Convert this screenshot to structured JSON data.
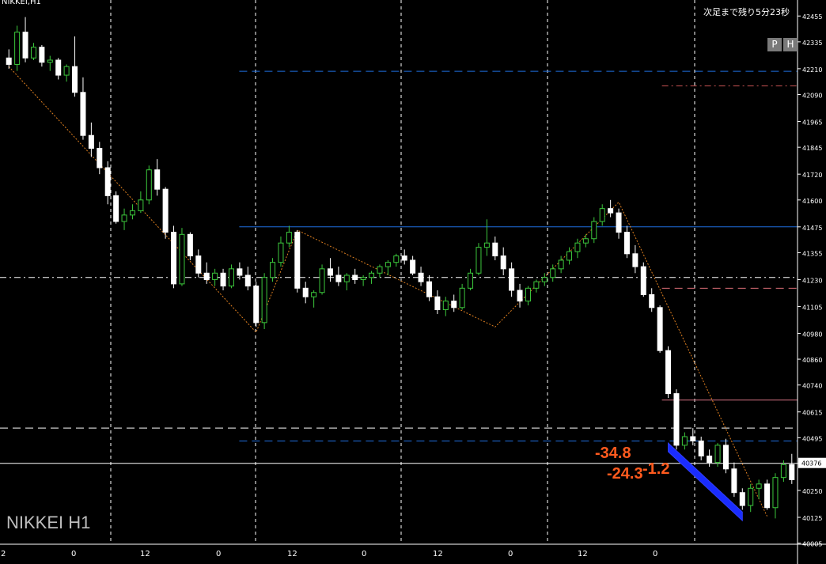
{
  "window": {
    "title": "NIKKEI,H1",
    "countdown": "次足まで残り5分23秒"
  },
  "buttons": {
    "p": "P",
    "h": "H"
  },
  "watermark": "NIKKEI H1",
  "current_price": "40376",
  "annotations": [
    "-34.8",
    "-24.3",
    "-1.2"
  ],
  "chart_data": {
    "type": "candlestick",
    "title": "NIKKEI,H1",
    "ylim": [
      40000,
      42500
    ],
    "y_ticks": [
      "42455",
      "42335",
      "42210",
      "42090",
      "41965",
      "41845",
      "41720",
      "41600",
      "41475",
      "41355",
      "41230",
      "41105",
      "40980",
      "40860",
      "40740",
      "40615",
      "40495",
      "40376",
      "40250",
      "40125",
      "40005"
    ],
    "x_ticks": [
      "2",
      "0",
      "12",
      "0",
      "12",
      "0",
      "12",
      "0",
      "12",
      "0"
    ],
    "candles": [
      [
        42260,
        42300,
        42210,
        42230
      ],
      [
        42230,
        42410,
        42200,
        42380
      ],
      [
        42380,
        42450,
        42240,
        42260
      ],
      [
        42260,
        42330,
        42250,
        42310
      ],
      [
        42310,
        42320,
        42220,
        42240
      ],
      [
        42240,
        42270,
        42200,
        42250
      ],
      [
        42250,
        42260,
        42160,
        42180
      ],
      [
        42180,
        42230,
        42150,
        42220
      ],
      [
        42220,
        42360,
        42080,
        42100
      ],
      [
        42100,
        42170,
        41880,
        41900
      ],
      [
        41900,
        41960,
        41800,
        41840
      ],
      [
        41840,
        41870,
        41720,
        41750
      ],
      [
        41750,
        41780,
        41580,
        41620
      ],
      [
        41620,
        41640,
        41490,
        41500
      ],
      [
        41500,
        41560,
        41460,
        41530
      ],
      [
        41530,
        41580,
        41510,
        41550
      ],
      [
        41550,
        41640,
        41540,
        41600
      ],
      [
        41600,
        41760,
        41580,
        41740
      ],
      [
        41740,
        41790,
        41620,
        41650
      ],
      [
        41650,
        41660,
        41420,
        41450
      ],
      [
        41450,
        41480,
        41190,
        41210
      ],
      [
        41210,
        41470,
        41200,
        41440
      ],
      [
        41440,
        41450,
        41320,
        41340
      ],
      [
        41340,
        41370,
        41240,
        41260
      ],
      [
        41260,
        41310,
        41210,
        41230
      ],
      [
        41230,
        41280,
        41200,
        41260
      ],
      [
        41260,
        41280,
        41180,
        41200
      ],
      [
        41200,
        41300,
        41190,
        41280
      ],
      [
        41280,
        41310,
        41230,
        41250
      ],
      [
        41250,
        41290,
        41180,
        41200
      ],
      [
        41200,
        41220,
        41010,
        41030
      ],
      [
        41030,
        41260,
        41000,
        41240
      ],
      [
        41240,
        41330,
        41220,
        41310
      ],
      [
        41310,
        41430,
        41290,
        41400
      ],
      [
        41400,
        41480,
        41380,
        41450
      ],
      [
        41450,
        41460,
        41170,
        41190
      ],
      [
        41190,
        41220,
        41120,
        41150
      ],
      [
        41150,
        41180,
        41100,
        41170
      ],
      [
        41170,
        41300,
        41160,
        41280
      ],
      [
        41280,
        41330,
        41220,
        41250
      ],
      [
        41250,
        41290,
        41200,
        41220
      ],
      [
        41220,
        41260,
        41180,
        41250
      ],
      [
        41250,
        41280,
        41210,
        41230
      ],
      [
        41230,
        41250,
        41200,
        41240
      ],
      [
        41240,
        41270,
        41210,
        41260
      ],
      [
        41260,
        41300,
        41240,
        41290
      ],
      [
        41290,
        41320,
        41250,
        41310
      ],
      [
        41310,
        41350,
        41290,
        41340
      ],
      [
        41340,
        41370,
        41300,
        41320
      ],
      [
        41320,
        41340,
        41250,
        41260
      ],
      [
        41260,
        41290,
        41200,
        41220
      ],
      [
        41220,
        41250,
        41130,
        41150
      ],
      [
        41150,
        41180,
        41070,
        41090
      ],
      [
        41090,
        41150,
        41060,
        41130
      ],
      [
        41130,
        41160,
        41080,
        41100
      ],
      [
        41100,
        41210,
        41090,
        41190
      ],
      [
        41190,
        41280,
        41180,
        41260
      ],
      [
        41260,
        41400,
        41250,
        41380
      ],
      [
        41380,
        41510,
        41340,
        41400
      ],
      [
        41400,
        41430,
        41320,
        41340
      ],
      [
        41340,
        41380,
        41250,
        41280
      ],
      [
        41280,
        41310,
        41150,
        41180
      ],
      [
        41180,
        41210,
        41100,
        41130
      ],
      [
        41130,
        41200,
        41110,
        41190
      ],
      [
        41190,
        41230,
        41170,
        41220
      ],
      [
        41220,
        41260,
        41200,
        41240
      ],
      [
        41240,
        41300,
        41220,
        41280
      ],
      [
        41280,
        41340,
        41260,
        41320
      ],
      [
        41320,
        41380,
        41300,
        41360
      ],
      [
        41360,
        41420,
        41330,
        41400
      ],
      [
        41400,
        41440,
        41380,
        41420
      ],
      [
        41420,
        41520,
        41400,
        41500
      ],
      [
        41500,
        41580,
        41480,
        41560
      ],
      [
        41560,
        41600,
        41520,
        41540
      ],
      [
        41540,
        41560,
        41420,
        41450
      ],
      [
        41450,
        41480,
        41330,
        41350
      ],
      [
        41350,
        41390,
        41260,
        41290
      ],
      [
        41290,
        41310,
        41150,
        41160
      ],
      [
        41160,
        41190,
        41080,
        41100
      ],
      [
        41100,
        41110,
        40890,
        40900
      ],
      [
        40900,
        40920,
        40680,
        40700
      ],
      [
        40700,
        40720,
        40440,
        40460
      ],
      [
        40460,
        40520,
        40440,
        40500
      ],
      [
        40500,
        40540,
        40460,
        40480
      ],
      [
        40480,
        40500,
        40390,
        40410
      ],
      [
        40410,
        40440,
        40360,
        40380
      ],
      [
        40380,
        40470,
        40360,
        40460
      ],
      [
        40460,
        40490,
        40330,
        40350
      ],
      [
        40350,
        40380,
        40220,
        40240
      ],
      [
        40240,
        40260,
        40160,
        40180
      ],
      [
        40180,
        40280,
        40150,
        40260
      ],
      [
        40260,
        40300,
        40210,
        40280
      ],
      [
        40280,
        40300,
        40160,
        40170
      ],
      [
        40170,
        40330,
        40120,
        40310
      ],
      [
        40310,
        40390,
        40290,
        40370
      ],
      [
        40370,
        40420,
        40280,
        40300
      ]
    ],
    "zigzag": [
      [
        0,
        42220
      ],
      [
        30,
        40985
      ],
      [
        35,
        41460
      ],
      [
        59,
        41010
      ],
      [
        74,
        41590
      ],
      [
        92,
        40130
      ]
    ],
    "hlines": [
      {
        "price": 42198,
        "style": "dashed",
        "color": "#1f6fe0",
        "start": 0.3
      },
      {
        "price": 42130,
        "style": "dashdot",
        "color": "#c05050",
        "start": 0.83
      },
      {
        "price": 41475,
        "style": "solid",
        "color": "#1f6fe0",
        "start": 0.3
      },
      {
        "price": 41240,
        "style": "dashdot",
        "color": "#ffffff",
        "start": 0.0
      },
      {
        "price": 41190,
        "style": "dashed",
        "color": "#e0707a",
        "start": 0.83
      },
      {
        "price": 40670,
        "style": "solid",
        "color": "#d07080",
        "start": 0.83
      },
      {
        "price": 40540,
        "style": "dashed",
        "color": "#ffffff",
        "start": 0.0
      },
      {
        "price": 40480,
        "style": "dashed",
        "color": "#1f6fe0",
        "start": 0.3
      },
      {
        "price": 40376,
        "style": "solid",
        "color": "#ffffff",
        "start": 0.0
      }
    ]
  }
}
